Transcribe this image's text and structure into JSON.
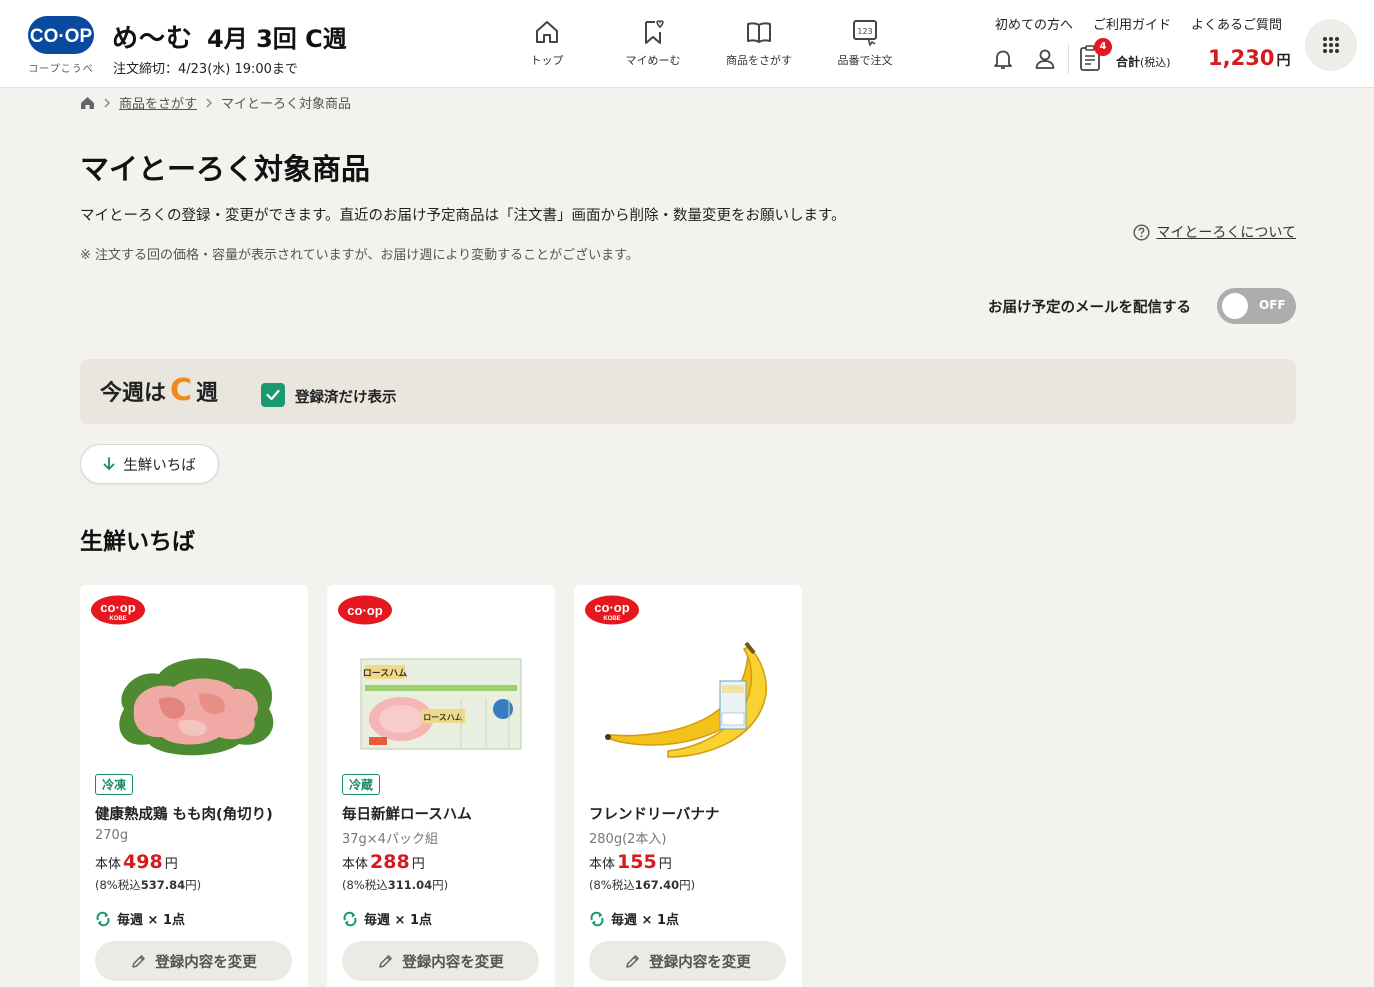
{
  "header": {
    "logo_text": "CO·OP",
    "logo_sub": "コープこうべ",
    "app_name": "め〜む",
    "week_title": "4月 3回 C週",
    "deadline": "注文締切：4/23(水) 19:00まで",
    "nav": [
      {
        "label": "トップ",
        "icon": "home-icon"
      },
      {
        "label": "マイめーむ",
        "icon": "bookmark-heart-icon"
      },
      {
        "label": "商品をさがす",
        "icon": "book-icon"
      },
      {
        "label": "品番で注文",
        "icon": "number-order-icon"
      }
    ],
    "links": [
      "初めての方へ",
      "ご利用ガイド",
      "よくあるご質問"
    ],
    "cart_count": "4",
    "total_label": "合計",
    "total_tax": "(税込)",
    "total_amount": "1,230",
    "currency": "円"
  },
  "breadcrumb": {
    "items": [
      "商品をさがす",
      "マイとーろく対象商品"
    ]
  },
  "page": {
    "title": "マイとーろく対象商品",
    "description": "マイとーろくの登録・変更ができます。直近のお届け予定商品は「注文書」画面から削除・数量変更をお願いします。",
    "note": "※ 注文する回の価格・容量が表示されていますが、お届け週により変動することがございます。",
    "about_link": "マイとーろくについて",
    "mail_label": "お届け予定のメールを配信する",
    "mail_toggle": "OFF"
  },
  "week": {
    "prefix": "今週は",
    "letter": "C",
    "suffix": "週",
    "filter_label": "登録済だけ表示",
    "filter_checked": true
  },
  "category_chip": "生鮮いちば",
  "section_title": "生鮮いちば",
  "products": [
    {
      "brand": "CO·OP KOBE",
      "tag": "冷凍",
      "name": "健康熟成鶏 もも肉(角切り)",
      "capacity": "270g",
      "price_label": "本体",
      "price": "498",
      "yen": "円",
      "tax_text": "(8%税込",
      "tax_price": "537.84",
      "tax_suffix": "円)",
      "freq": "毎週 × 1点",
      "button": "登録内容を変更"
    },
    {
      "brand": "CO·OP",
      "tag": "冷蔵",
      "name": "毎日新鮮ロースハム",
      "capacity": "37g×4パック組",
      "price_label": "本体",
      "price": "288",
      "yen": "円",
      "tax_text": "(8%税込",
      "tax_price": "311.04",
      "tax_suffix": "円)",
      "freq": "毎週 × 1点",
      "button": "登録内容を変更"
    },
    {
      "brand": "CO·OP KOBE",
      "tag": "",
      "name": "フレンドリーバナナ",
      "capacity": "280g(2本入)",
      "price_label": "本体",
      "price": "155",
      "yen": "円",
      "tax_text": "(8%税込",
      "tax_price": "167.40",
      "tax_suffix": "円)",
      "freq": "毎週 × 1点",
      "button": "登録内容を変更"
    }
  ],
  "colors": {
    "brand_blue": "#0a4a9e",
    "price_red": "#d61a1f",
    "accent_green": "#1a9a6e",
    "week_orange": "#f08a1c"
  }
}
